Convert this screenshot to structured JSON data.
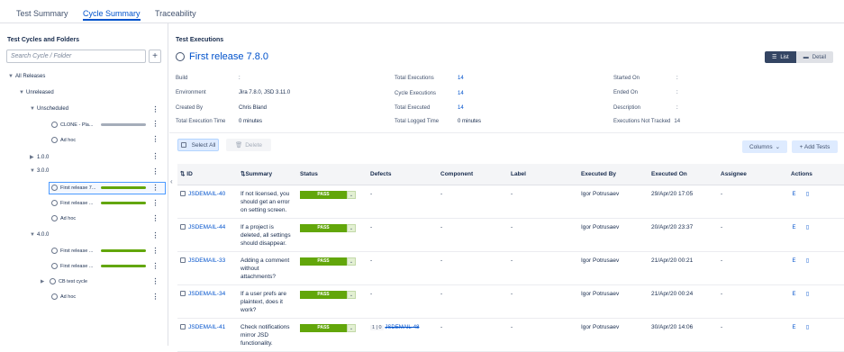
{
  "tabs": [
    {
      "label": "Test Summary"
    },
    {
      "label": "Cycle Summary"
    },
    {
      "label": "Traceability"
    }
  ],
  "left": {
    "title": "Test Cycles and Folders",
    "search_placeholder": "Search Cycle / Folder",
    "add_button": "+",
    "tree": {
      "all_releases": "All Releases",
      "unreleased": "Unreleased",
      "unscheduled": "Unscheduled",
      "cycle_clone": "CLONE - Pla...",
      "cycle_adhoc1": "Ad hoc",
      "v100": "1.0.0",
      "v300": "3.0.0",
      "cycle_fr1": "First release 7...",
      "cycle_fr2": "First release ...",
      "cycle_adhoc2": "Ad hoc",
      "v400": "4.0.0",
      "cycle_fr3": "First release ...",
      "cycle_fr4": "First release ...",
      "cycle_cb": "CB test cycle",
      "cycle_adhoc3": "Ad hoc"
    }
  },
  "main": {
    "section_title": "Test Executions",
    "cycle_title": "First release 7.8.0",
    "view_list": "List",
    "view_detail": "Detail",
    "meta": {
      "build_label": "Build",
      "build_value": ":",
      "environment_label": "Environment",
      "environment_value": "Jira 7.8.0, JSD 3.11.0",
      "created_by_label": "Created By",
      "created_by_value": "Chris Bland",
      "total_exec_time_label": "Total Execution Time",
      "total_exec_time_value": "0 minutes",
      "total_executions_label": "Total Executions",
      "total_executions_value": "14",
      "cycle_executions_label": "Cycle Executions",
      "cycle_executions_value": "14",
      "total_executed_label": "Total Executed",
      "total_executed_value": "14",
      "total_logged_label": "Total Logged Time",
      "total_logged_value": "0 minutes",
      "started_on_label": "Started On",
      "started_on_value": ":",
      "ended_on_label": "Ended On",
      "ended_on_value": ":",
      "description_label": "Description",
      "description_value": ":",
      "not_tracked_label": "Executions Not Tracked",
      "not_tracked_value": "14"
    },
    "toolbar": {
      "select_all": "Select All",
      "delete": "Delete",
      "columns": "Columns",
      "add_tests": "+ Add Tests"
    },
    "table": {
      "headers": {
        "id": "ID",
        "summary": "Summary",
        "status": "Status",
        "defects": "Defects",
        "component": "Component",
        "label": "Label",
        "executed_by": "Executed By",
        "executed_on": "Executed On",
        "assignee": "Assignee",
        "actions": "Actions"
      },
      "rows": [
        {
          "id": "JSDEMAIL-40",
          "summary": "If not licensed, you should get an error on setting screen.",
          "status": "PASS",
          "defects": "-",
          "component": "-",
          "label": "-",
          "executed_by": "Igor Potrusaev",
          "executed_on": "29/Apr/20 17:05",
          "assignee": "-"
        },
        {
          "id": "JSDEMAIL-44",
          "summary": "If a project is deleted, all settings should disappear.",
          "status": "PASS",
          "defects": "-",
          "component": "-",
          "label": "-",
          "executed_by": "Igor Potrusaev",
          "executed_on": "20/Apr/20 23:37",
          "assignee": "-"
        },
        {
          "id": "JSDEMAIL-33",
          "summary": "Adding a comment without attachments?",
          "status": "PASS",
          "defects": "-",
          "component": "-",
          "label": "-",
          "executed_by": "Igor Potrusaev",
          "executed_on": "21/Apr/20 00:21",
          "assignee": "-"
        },
        {
          "id": "JSDEMAIL-34",
          "summary": "If a user prefs are plaintext, does it work?",
          "status": "PASS",
          "defects": "-",
          "component": "-",
          "label": "-",
          "executed_by": "Igor Potrusaev",
          "executed_on": "21/Apr/20 00:24",
          "assignee": "-"
        },
        {
          "id": "JSDEMAIL-41",
          "summary": "Check notifications mirror JSD functionality.",
          "status": "PASS",
          "defects": "JSDEMAIL-48",
          "defect_count": "1 | 0",
          "component": "-",
          "label": "-",
          "executed_by": "Igor Potrusaev",
          "executed_on": "30/Apr/20 14:06",
          "assignee": "-"
        }
      ]
    }
  },
  "colors": {
    "accent": "#0052cc",
    "pass": "#62a60a",
    "bar_grey": "#a5adba",
    "bar_green": "#62a60a"
  }
}
